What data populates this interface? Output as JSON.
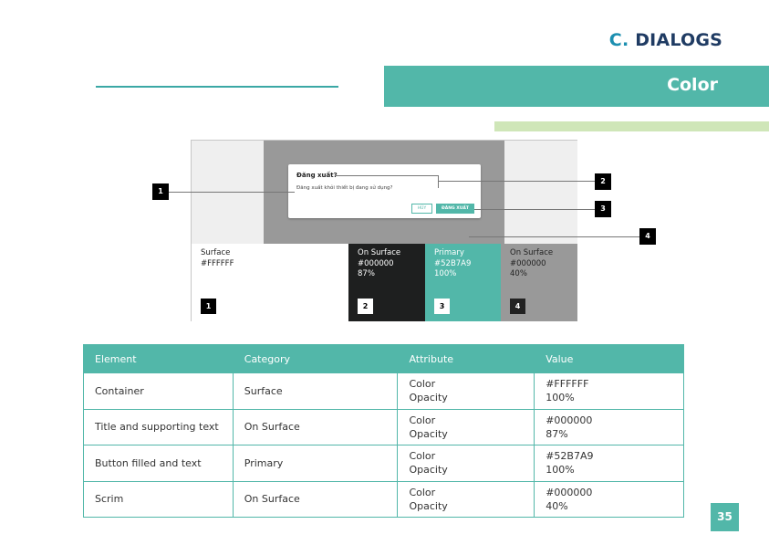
{
  "header": {
    "section_prefix": "C.",
    "section_title": "DIALOGS"
  },
  "banner": {
    "title": "Color"
  },
  "illustration": {
    "dialog": {
      "title": "Đăng xuất?",
      "body": "Đăng xuất khỏi thiết bị đang sử dụng?",
      "text_button": "HỦY",
      "filled_button": "ĐĂNG XUẤT"
    },
    "swatches": [
      {
        "name": "Surface",
        "hex": "#FFFFFF",
        "opacity": "",
        "number": "1"
      },
      {
        "name": "On Surface",
        "hex": "#000000",
        "opacity": "87%",
        "number": "2"
      },
      {
        "name": "Primary",
        "hex": "#52B7A9",
        "opacity": "100%",
        "number": "3"
      },
      {
        "name": "On Surface",
        "hex": "#000000",
        "opacity": "40%",
        "number": "4"
      }
    ],
    "callouts": [
      "1",
      "2",
      "3",
      "4"
    ]
  },
  "table": {
    "headers": [
      "Element",
      "Category",
      "Attribute",
      "Value"
    ],
    "rows": [
      {
        "element": "Container",
        "category": "Surface",
        "attr1": "Color",
        "attr2": "Opacity",
        "val1": "#FFFFFF",
        "val2": "100%"
      },
      {
        "element": "Title and supporting text",
        "category": "On Surface",
        "attr1": "Color",
        "attr2": "Opacity",
        "val1": "#000000",
        "val2": "87%"
      },
      {
        "element": "Button filled and text",
        "category": "Primary",
        "attr1": "Color",
        "attr2": "Opacity",
        "val1": "#52B7A9",
        "val2": "100%"
      },
      {
        "element": "Scrim",
        "category": "On Surface",
        "attr1": "Color",
        "attr2": "Opacity",
        "val1": "#000000",
        "val2": "40%"
      }
    ]
  },
  "page_number": "35",
  "colors": {
    "primary": "#52B7A9",
    "heading_dark": "#1F3B63",
    "heading_accent": "#1C8FB0",
    "accent_light": "#CFE6B8"
  }
}
